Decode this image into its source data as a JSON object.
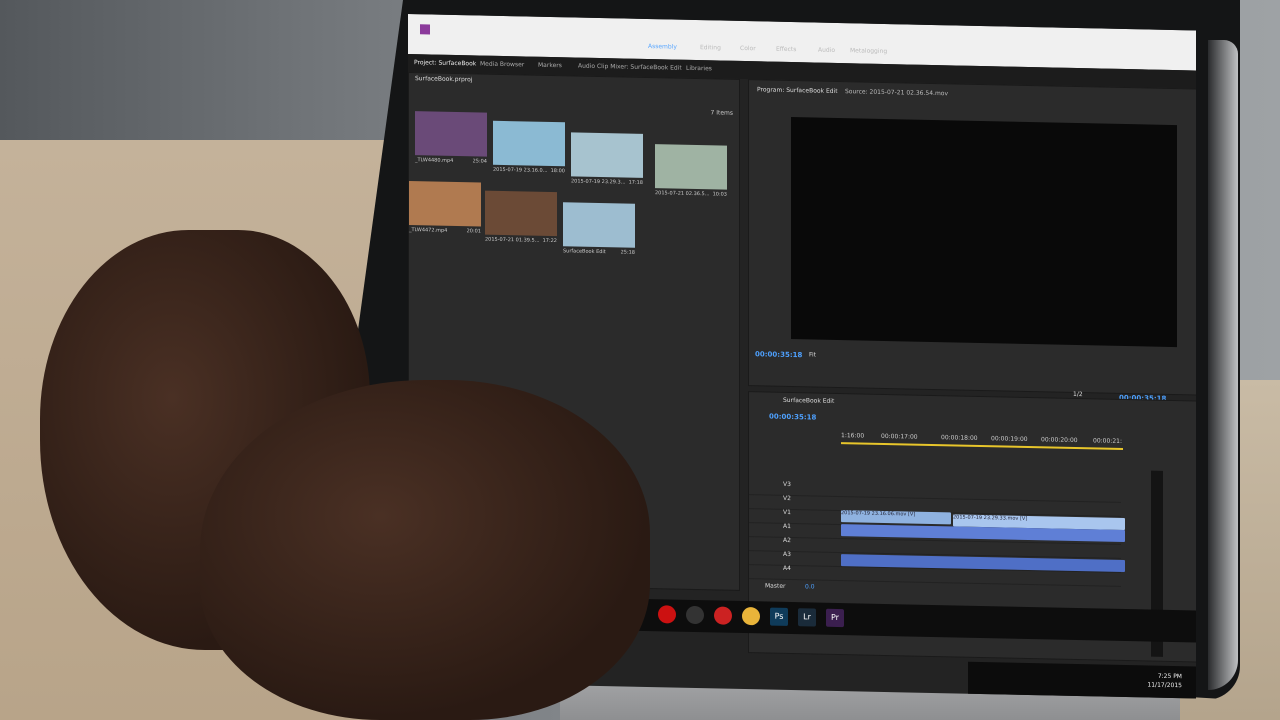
{
  "app": {
    "tabs": [
      "Project: SurfaceBook",
      "Media Browser",
      "Markers",
      "Audio Clip Mixer: SurfaceBook Edit",
      "Libraries"
    ],
    "workspaces": [
      "Assembly",
      "Editing",
      "Color",
      "Effects",
      "Audio",
      "Metalogging"
    ],
    "active_workspace": "Assembly"
  },
  "project": {
    "file": "SurfaceBook.prproj",
    "item_count": "7 Items",
    "clips": [
      {
        "name": "_TLW4480.mp4",
        "duration": "25:04",
        "color": "#6a4a78"
      },
      {
        "name": "2015-07-19 23.16.0...",
        "duration": "18:00",
        "color": "#8bbad3"
      },
      {
        "name": "2015-07-19 23.29.3...",
        "duration": "17:18",
        "color": "#a7c3cf"
      },
      {
        "name": "2015-07-21 02.36.5...",
        "duration": "10:03",
        "color": "#9fb3a3"
      },
      {
        "name": "_TLW4472.mp4",
        "duration": "20:01",
        "color": "#b07a50"
      },
      {
        "name": "2015-07-21 01.39.5...",
        "duration": "17:22",
        "color": "#6b4a36"
      },
      {
        "name": "SurfaceBook Edit",
        "duration": "25:18",
        "color": "#9dbdd0"
      }
    ]
  },
  "program": {
    "label": "Program: SurfaceBook Edit",
    "source": "Source: 2015-07-21 02.36.54.mov",
    "timecode": "00:00:35:18",
    "fit": "Fit",
    "zoom": "1/2",
    "timecode_right": "00:00:35:18"
  },
  "timeline": {
    "sequence": "SurfaceBook Edit",
    "timecode": "00:00:35:18",
    "ruler": [
      "1:16:00",
      "00:00:17:00",
      "00:00:18:00",
      "00:00:19:00",
      "00:00:20:00",
      "00:00:21:"
    ],
    "tracks": [
      "V3",
      "V2",
      "V1",
      "A1",
      "A2",
      "A3",
      "A4"
    ],
    "master_label": "Master",
    "master_value": "0.0",
    "clip_v1a": "2015-07-19 23.16.06.mov [V]",
    "clip_v1b": "2015-07-19 23.29.33.mov [V]"
  },
  "system": {
    "time": "7:25 PM",
    "date": "11/17/2015"
  },
  "colors": {
    "accent": "#4ea1ff",
    "clip_video": "#8fb2e0",
    "clip_audio": "#5f7fd6",
    "premiere_icon": "#3b1f4f"
  }
}
